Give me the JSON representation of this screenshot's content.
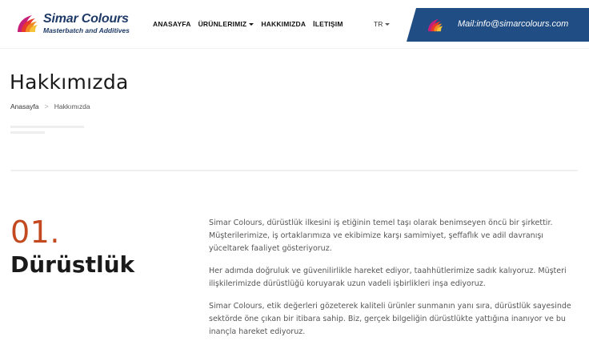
{
  "brand": {
    "name": "Simar Colours",
    "tagline": "Masterbatch and Additives",
    "logo_colors": [
      "#e8392b",
      "#f08a24",
      "#f6c23a",
      "#c6207a"
    ]
  },
  "nav": {
    "items": [
      {
        "label": "ANASAYFA",
        "dropdown": false
      },
      {
        "label": "ÜRÜNLERIMIZ",
        "dropdown": true
      },
      {
        "label": "HAKKIMIZDA",
        "dropdown": false
      },
      {
        "label": "İLETIŞIM",
        "dropdown": false
      }
    ],
    "language": "TR"
  },
  "contact": {
    "mail": "Mail:info@simarcolours.com",
    "bar_color": "#1f4d84"
  },
  "page": {
    "title": "Hakkımızda",
    "breadcrumb": {
      "home": "Anasayfa",
      "separator": ">",
      "current": "Hakkımızda"
    }
  },
  "section": {
    "number": "01.",
    "number_color": "#c34920",
    "heading": "Dürüstlük",
    "paragraphs": [
      "Simar Colours, dürüstlük ilkesini iş etiğinin temel taşı olarak benimseyen öncü bir şirkettir. Müşterilerimize, iş ortaklarımıza ve ekibimize karşı samimiyet, şeffaflık ve adil davranışı yüceltarek faaliyet gösteriyoruz.",
      "Her adımda doğruluk ve güvenilirlikle hareket ediyor, taahhütlerimize sadık kalıyoruz. Müşteri ilişkilerimizde dürüstlüğü koruyarak uzun vadeli işbirlikleri inşa ediyoruz.",
      "Simar Colours, etik değerleri gözeterek kaliteli ürünler sunmanın yanı sıra, dürüstlük sayesinde sektörde öne çıkan bir itibara sahip. Biz, gerçek bilgeliğin dürüstlükte yattığına inanıyor ve bu inançla hareket ediyoruz."
    ]
  }
}
